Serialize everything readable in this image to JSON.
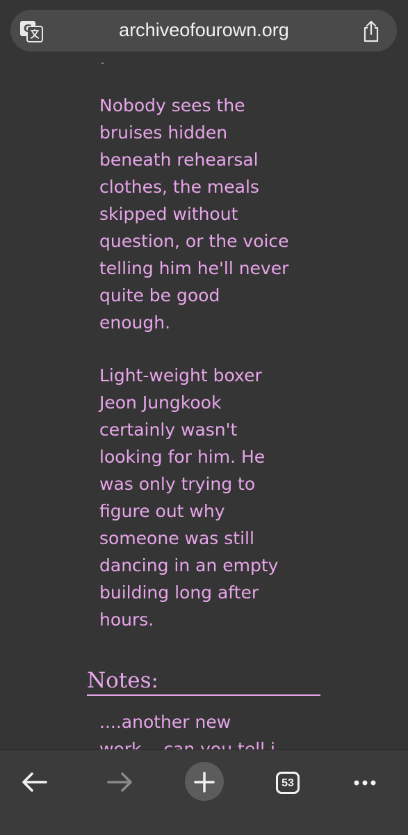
{
  "browser": {
    "url": "archiveofourown.org",
    "tab_count": "53",
    "icons": {
      "translate": "translate-icon",
      "share": "share-icon",
      "back": "back-arrow-icon",
      "forward": "forward-arrow-icon",
      "new_tab": "plus-icon",
      "tabs": "tabs-icon",
      "more": "more-icon"
    }
  },
  "summary": {
    "paragraphs": [
      "Nobody sees the\nbruises hidden\nbeneath rehearsal\nclothes, the meals\nskipped without\nquestion, or the voice\ntelling him he'll never\nquite be good\nenough.",
      "Light-weight boxer\nJeon Jungkook\ncertainly wasn't\nlooking for him. He\nwas only trying to\nfigure out why\nsomeone was still\ndancing in an empty\nbuilding long after\nhours."
    ]
  },
  "notes": {
    "heading": "Notes:",
    "text": "....another new\nwork... can you tell i"
  },
  "colors": {
    "background": "#353535",
    "text": "#e7a5ea",
    "toolbar": "#3b3b3b",
    "url_pill": "#4a4a4a"
  }
}
